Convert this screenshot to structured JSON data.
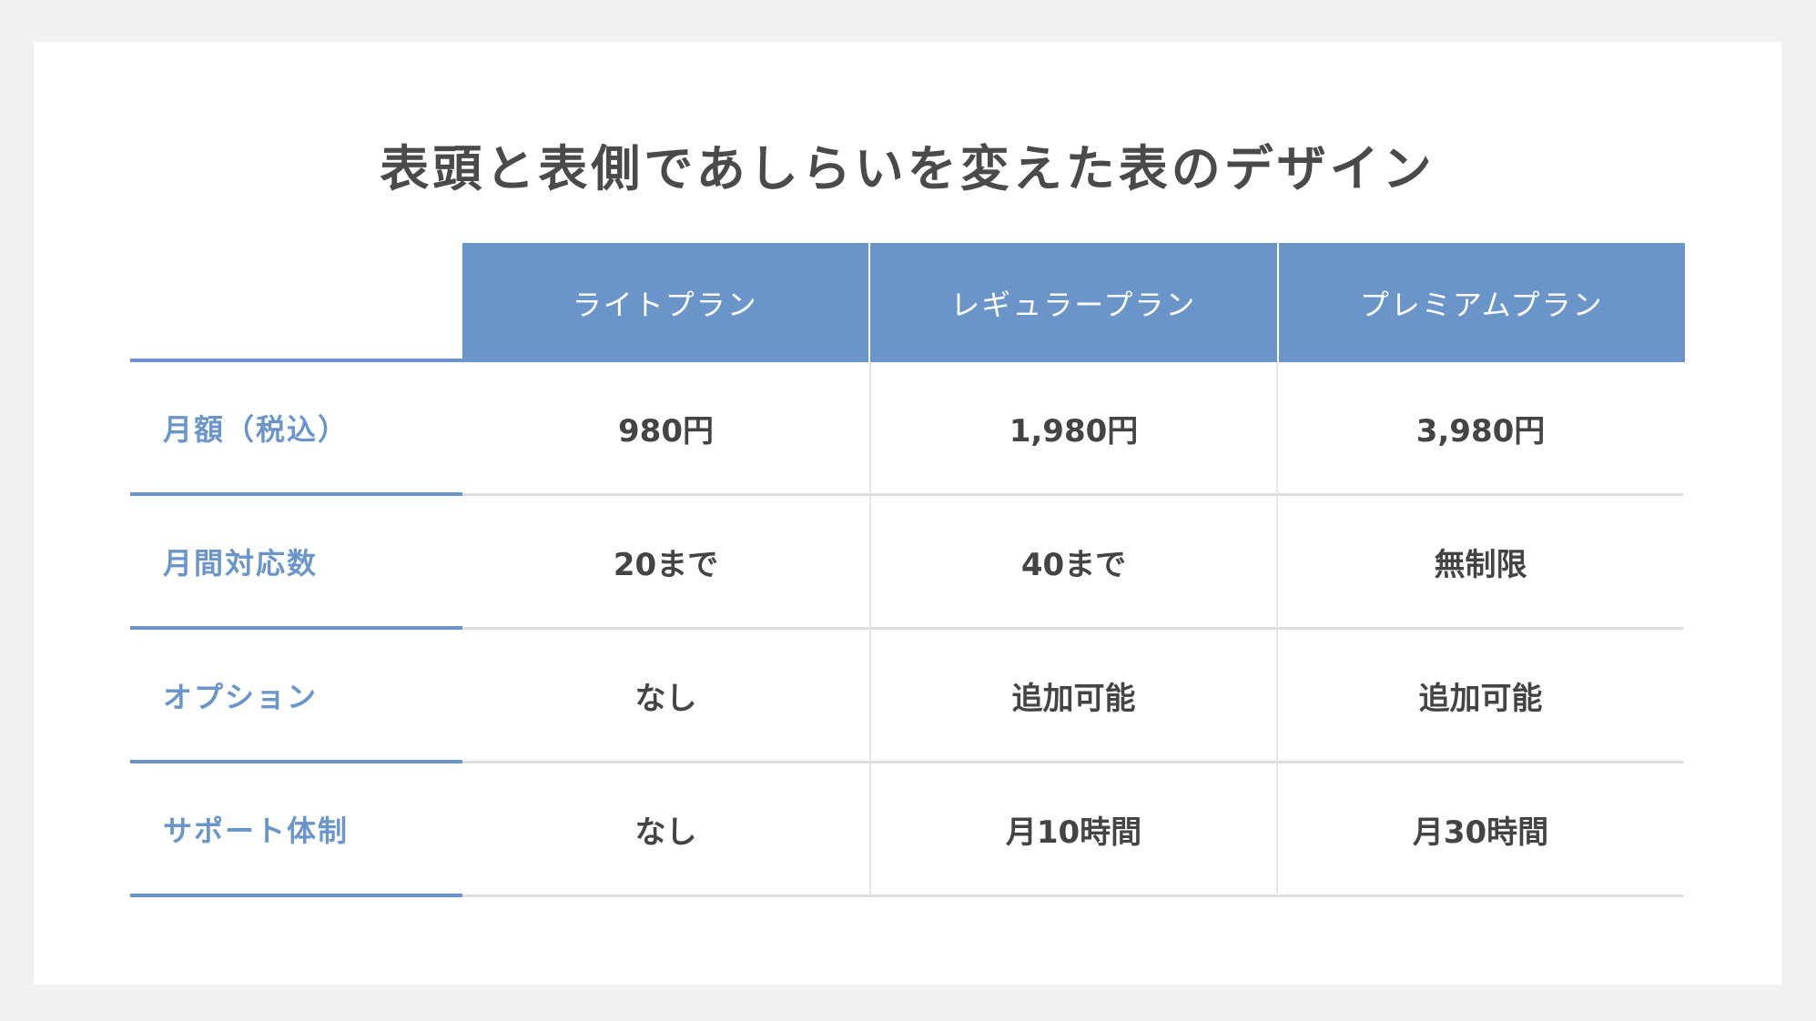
{
  "title": "表頭と表側であしらいを変えた表のデザイン",
  "colors": {
    "accent": "#6b95c8",
    "text": "#444444",
    "background": "#f1f1f1",
    "card": "#ffffff",
    "divider": "#dddddd"
  },
  "table": {
    "columns": [
      "ライトプラン",
      "レギュラープラン",
      "プレミアムプラン"
    ],
    "rows": [
      {
        "label": "月額（税込）",
        "values": [
          "980円",
          "1,980円",
          "3,980円"
        ]
      },
      {
        "label": "月間対応数",
        "values": [
          "20まで",
          "40まで",
          "無制限"
        ]
      },
      {
        "label": "オプション",
        "values": [
          "なし",
          "追加可能",
          "追加可能"
        ]
      },
      {
        "label": "サポート体制",
        "values": [
          "なし",
          "月10時間",
          "月30時間"
        ]
      }
    ]
  }
}
